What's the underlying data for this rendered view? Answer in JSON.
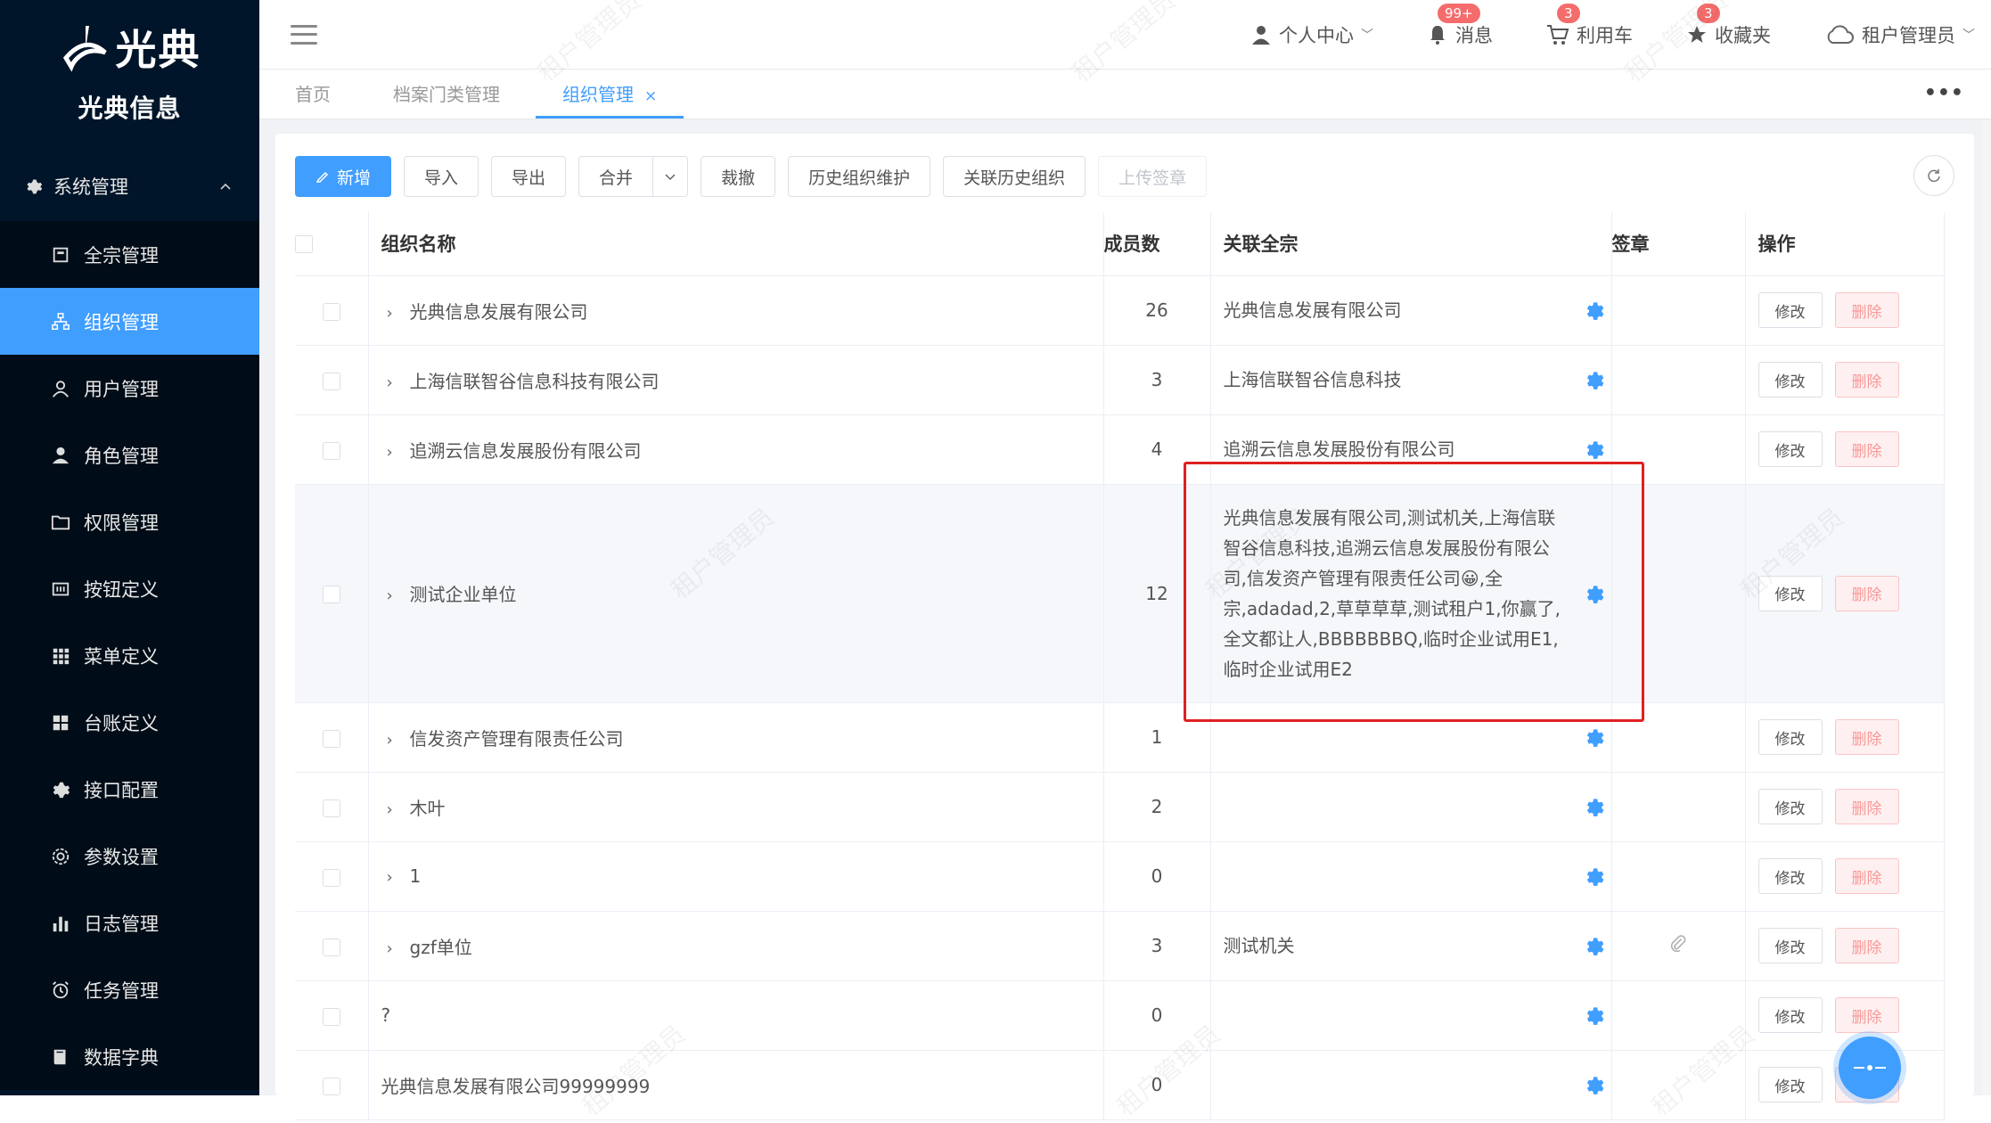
{
  "brand": {
    "logo_text": "光典",
    "name": "光典信息"
  },
  "sidebar": {
    "group_label": "系统管理",
    "items": [
      {
        "label": "全宗管理",
        "icon": "archive-icon",
        "active": false
      },
      {
        "label": "组织管理",
        "icon": "org-tree-icon",
        "active": true
      },
      {
        "label": "用户管理",
        "icon": "user-outline-icon",
        "active": false
      },
      {
        "label": "角色管理",
        "icon": "user-filled-icon",
        "active": false
      },
      {
        "label": "权限管理",
        "icon": "folder-icon",
        "active": false
      },
      {
        "label": "按钮定义",
        "icon": "button-icon",
        "active": false
      },
      {
        "label": "菜单定义",
        "icon": "grid-icon",
        "active": false
      },
      {
        "label": "台账定义",
        "icon": "tiles-icon",
        "active": false
      },
      {
        "label": "接口配置",
        "icon": "gear-icon",
        "active": false
      },
      {
        "label": "参数设置",
        "icon": "settings-icon",
        "active": false
      },
      {
        "label": "日志管理",
        "icon": "bar-chart-icon",
        "active": false
      },
      {
        "label": "任务管理",
        "icon": "alarm-icon",
        "active": false
      },
      {
        "label": "数据字典",
        "icon": "book-icon",
        "active": false
      }
    ]
  },
  "header": {
    "personal_center": "个人中心",
    "messages": {
      "label": "消息",
      "badge": "99+"
    },
    "cart": {
      "label": "利用车",
      "badge": "3"
    },
    "favorites": {
      "label": "收藏夹",
      "badge": "3"
    },
    "user": "租户管理员"
  },
  "tabs": [
    {
      "label": "首页",
      "active": false
    },
    {
      "label": "档案门类管理",
      "active": false
    },
    {
      "label": "组织管理",
      "active": true,
      "close": "×"
    }
  ],
  "tab_more": "•••",
  "toolbar": {
    "add": "新增",
    "import": "导入",
    "export": "导出",
    "merge": "合并",
    "revoke": "裁撤",
    "history_maintain": "历史组织维护",
    "link_history": "关联历史组织",
    "upload_seal": "上传签章"
  },
  "table": {
    "headers": {
      "name": "组织名称",
      "members": "成员数",
      "related": "关联全宗",
      "seal": "签章",
      "ops": "操作"
    },
    "edit_label": "修改",
    "delete_label": "删除",
    "rows": [
      {
        "name": "光典信息发展有限公司",
        "members": "26",
        "related": "光典信息发展有限公司",
        "expandable": true,
        "seal": false
      },
      {
        "name": "上海信联智谷信息科技有限公司",
        "members": "3",
        "related": "上海信联智谷信息科技",
        "expandable": true,
        "seal": false
      },
      {
        "name": "追溯云信息发展股份有限公司",
        "members": "4",
        "related": "追溯云信息发展股份有限公司",
        "expandable": true,
        "seal": false
      },
      {
        "name": "测试企业单位",
        "members": "12",
        "related": "光典信息发展有限公司,测试机关,上海信联智谷信息科技,追溯云信息发展股份有限公司,信发资产管理有限责任公司😀,全宗,adadad,2,草草草草,测试租户1,你赢了,全文都让人,BBBBBBBQ,临时企业试用E1,临时企业试用E2",
        "expandable": true,
        "seal": false,
        "tall": true
      },
      {
        "name": "信发资产管理有限责任公司",
        "members": "1",
        "related": "",
        "expandable": true,
        "seal": false
      },
      {
        "name": "木叶",
        "members": "2",
        "related": "",
        "expandable": true,
        "seal": false
      },
      {
        "name": "1",
        "members": "0",
        "related": "",
        "expandable": true,
        "seal": false
      },
      {
        "name": "gzf单位",
        "members": "3",
        "related": "测试机关",
        "expandable": true,
        "seal": true
      },
      {
        "name": "?",
        "members": "0",
        "related": "",
        "expandable": false,
        "seal": false
      },
      {
        "name": "光典信息发展有限公司99999999",
        "members": "0",
        "related": "",
        "expandable": false,
        "seal": false
      }
    ]
  },
  "watermark_text": "租户管理员",
  "colors": {
    "sidebar_bg": "#001529",
    "accent": "#409eff",
    "danger": "#f56c6c",
    "highlight": "#e02020"
  }
}
